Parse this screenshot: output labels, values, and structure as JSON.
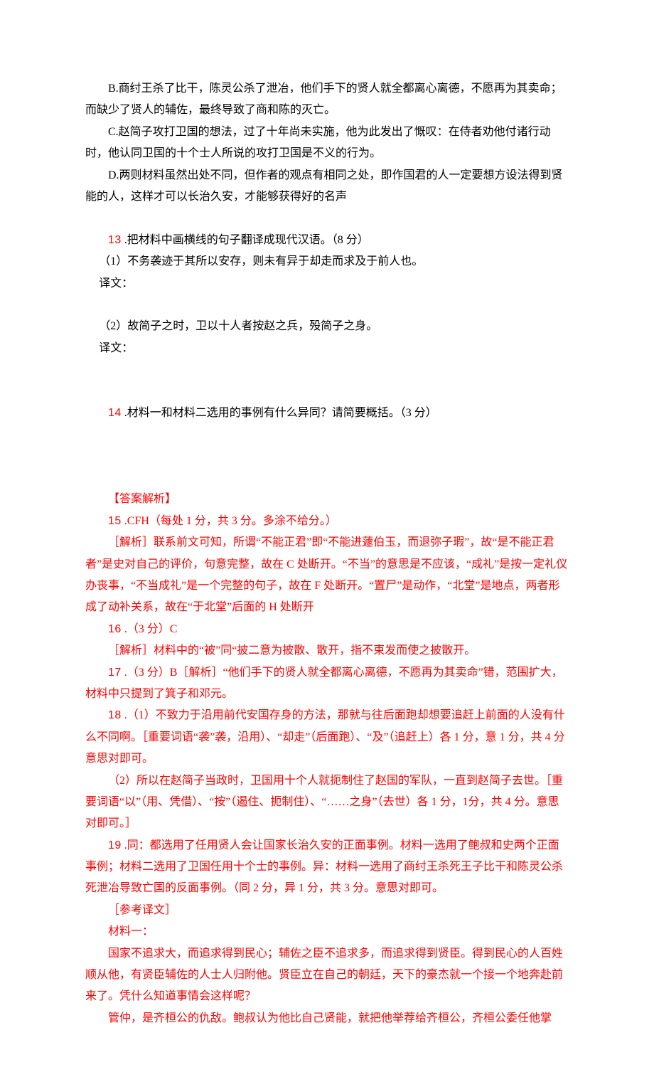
{
  "options": {
    "B": "B.商纣王杀了比干，陈灵公杀了泄冶，他们手下的贤人就全都离心离德，不愿再为其卖命；而缺少了贤人的辅佐，最终导致了商和陈的灭亡。",
    "C": "C.赵简子攻打卫国的想法，过了十年尚未实施，他为此发出了慨叹：在侍者劝他付诸行动时，他认同卫国的十个士人所说的攻打卫国是不义的行为。",
    "D": "D.两则材料虽然出处不同，但作者的观点有相同之处，即作国君的人一定要想方设法得到贤能的人，这样才可以长治久安，才能够获得好的名声"
  },
  "q13": {
    "number": "13",
    "stem": " .把材料中画横线的句子翻译成现代汉语。（8 分）",
    "item1": "（1）不务袭迹于其所以安存，则未有异于却走而求及于前人也。",
    "yiwen_label": "译文：",
    "item2": "（2）故简子之时，卫以十人者按赵之兵，殁简子之身。"
  },
  "q14": {
    "number": "14",
    "text": " .材料一和材料二选用的事例有什么异同？请简要概括。（3 分）"
  },
  "answers": {
    "heading": "【答案解析】",
    "a15": {
      "num": "15",
      "text": " .CFH（每处 1 分，共 3 分。多涂不给分。）",
      "explain": "［解析］联系前文可知，所谓“不能正君”即“不能进蘧伯玉，而退弥子瑕”，故“是不能正君者”是史对自己的评价，句意完整，故在 C 处断开。“不当”的意思是不应该，“成礼”是按一定礼仪办丧事，“不当成礼”是一个完整的句子，故在 F 处断开。“置尸”是动作，“北堂”是地点，两者形成了动补关系，故在“于北堂”后面的 H 处断开"
    },
    "a16": {
      "num": "16",
      "text": " .（3 分）C",
      "explain": "［解析］材料中的“被”同“披二意为披散、散开，指不束发而使之披散开。"
    },
    "a17": {
      "num": "17",
      "text": " .（3 分）B［解析］“他们手下的贤人就全都离心离德，不愿再为其卖命”错，范围扩大，材料中只提到了箕子和邓元。"
    },
    "a18": {
      "num": "18",
      "p1": " .（1）不致力于沿用前代安国存身的方法，那就与往后面跑却想要追赶上前面的人没有什么不同啊。［重要词语“袭”袭，沿用）、“却走”（后面跑）、“及”（追赶上）各 1 分，意 1 分，共 4 分意思对即可。",
      "p2": "（2）所以在赵简子当政时，卫国用十个人就扼制住了赵国的军队，一直到赵简子去世。［重要词语“以”（用、凭借）、“按”（遏住、扼制住）、“……之身”（去世）各 1 分，1分，共 4 分。意思对即可。］"
    },
    "a19": {
      "num": "19",
      "text": " .同：都选用了任用贤人会让国家长治久安的正面事例。材料一选用了鲍叔和史两个正面事例；材料二选用了卫国任用十个士的事例。异：材料一选用了商纣王杀死王子比干和陈灵公杀死泄冶导致亡国的反面事例。（同 2 分，异 1 分，共 3 分。意思对即可。"
    },
    "ref": {
      "label": "［参考译文］",
      "m1_label": "材料一：",
      "p1": "国家不追求大，而追求得到民心；辅佐之臣不追求多，而追求得到贤臣。得到民心的人百姓顺从他，有贤臣辅佐的人士人归附他。贤臣立在自己的朝廷，天下的豪杰就一个接一个地奔赴前来了。凭什么知道事情会这样呢？",
      "p2": "管仲，是齐桓公的仇敌。鲍叔认为他比自己贤能，就把他举荐给齐桓公，齐桓公委任他掌"
    }
  }
}
